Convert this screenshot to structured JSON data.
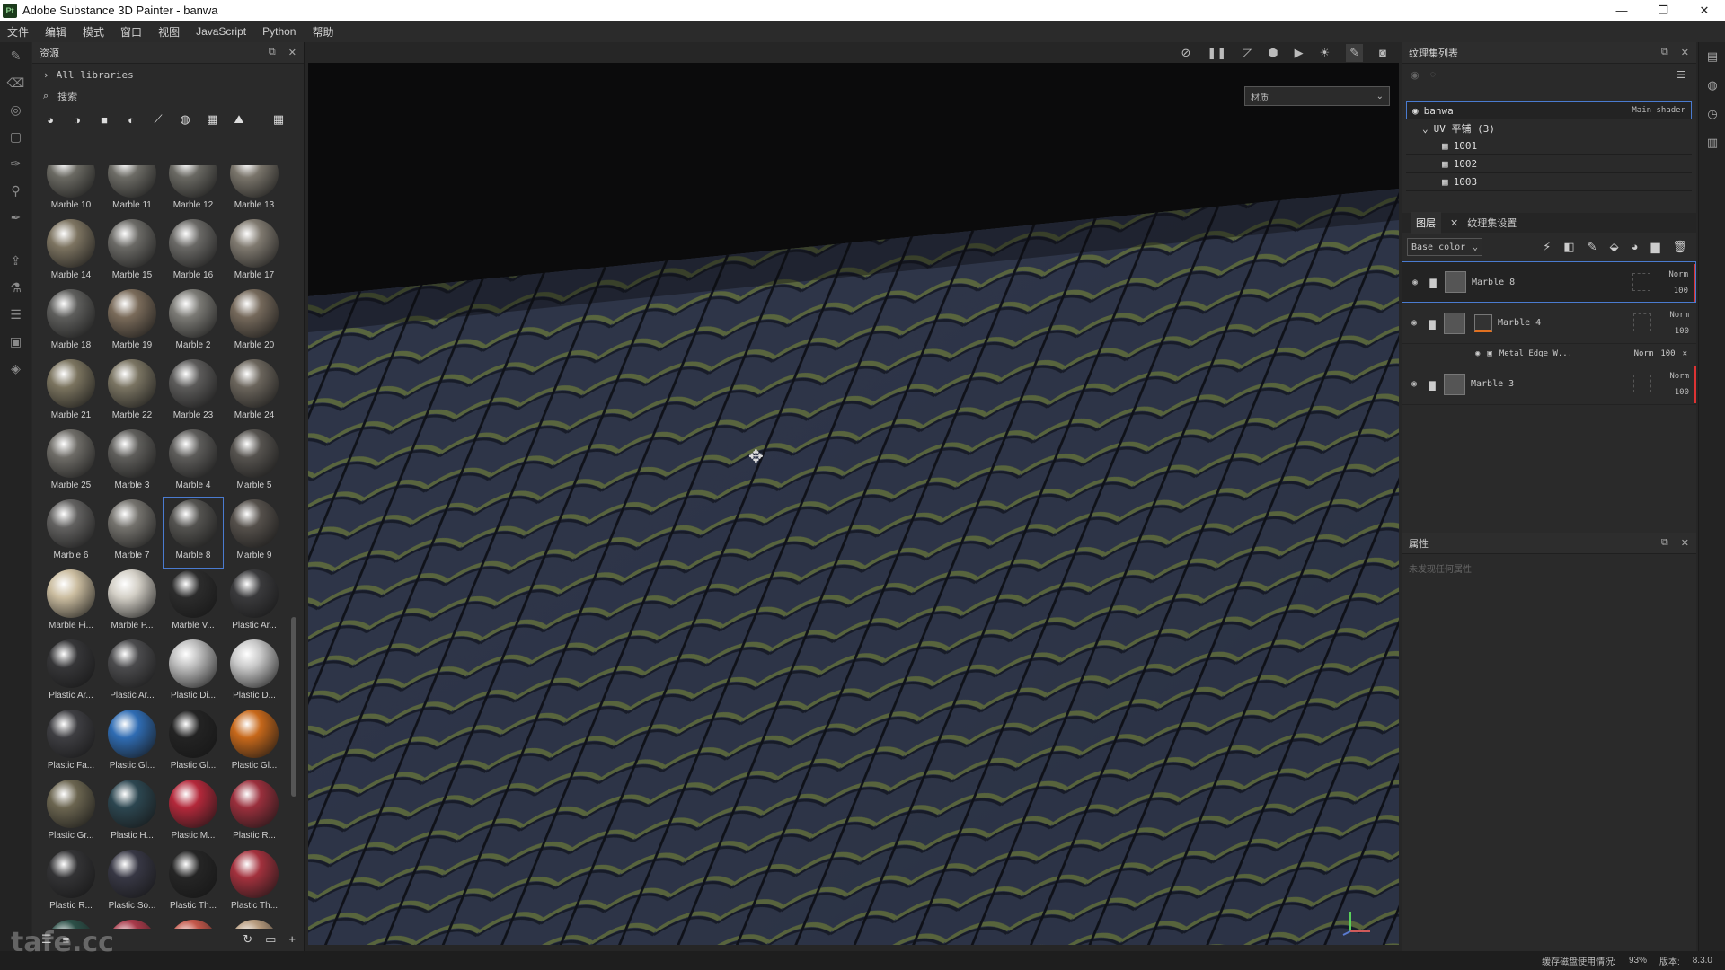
{
  "app": {
    "title": "Adobe Substance 3D Painter - banwa",
    "logo": "Pt"
  },
  "window_controls": {
    "minimize": "—",
    "maximize": "❐",
    "close": "✕"
  },
  "menu": [
    "文件",
    "编辑",
    "模式",
    "窗口",
    "视图",
    "JavaScript",
    "Python",
    "帮助"
  ],
  "assets": {
    "title": "资源",
    "breadcrumb": "All libraries",
    "search_placeholder": "搜索",
    "items": [
      {
        "name": "Marble 10",
        "color": "#6b6a63"
      },
      {
        "name": "Marble 11",
        "color": "#6d6c66"
      },
      {
        "name": "Marble 12",
        "color": "#6a6963"
      },
      {
        "name": "Marble 13",
        "color": "#7a756b"
      },
      {
        "name": "Marble 14",
        "color": "#7d7461"
      },
      {
        "name": "Marble 15",
        "color": "#6b6a66"
      },
      {
        "name": "Marble 16",
        "color": "#6a6966"
      },
      {
        "name": "Marble 17",
        "color": "#807a70"
      },
      {
        "name": "Marble 18",
        "color": "#5e5e5c"
      },
      {
        "name": "Marble 19",
        "color": "#7a6b5a"
      },
      {
        "name": "Marble 2",
        "color": "#7b7a75"
      },
      {
        "name": "Marble 20",
        "color": "#75695b"
      },
      {
        "name": "Marble 21",
        "color": "#7b745f"
      },
      {
        "name": "Marble 22",
        "color": "#7a7462"
      },
      {
        "name": "Marble 23",
        "color": "#5c5b5a"
      },
      {
        "name": "Marble 24",
        "color": "#6b655c"
      },
      {
        "name": "Marble 25",
        "color": "#6e6c67"
      },
      {
        "name": "Marble 3",
        "color": "#5f5e5b"
      },
      {
        "name": "Marble 4",
        "color": "#5d5c5a"
      },
      {
        "name": "Marble 5",
        "color": "#56534f"
      },
      {
        "name": "Marble 6",
        "color": "#626160"
      },
      {
        "name": "Marble 7",
        "color": "#74726d"
      },
      {
        "name": "Marble 8",
        "color": "#545350"
      },
      {
        "name": "Marble 9",
        "color": "#55504b"
      },
      {
        "name": "Marble Fi...",
        "color": "#cbbda0"
      },
      {
        "name": "Marble P...",
        "color": "#d3cfc6"
      },
      {
        "name": "Marble V...",
        "color": "#2c2c2c"
      },
      {
        "name": "Plastic Ar...",
        "color": "#3a3a3c"
      },
      {
        "name": "Plastic Ar...",
        "color": "#363638"
      },
      {
        "name": "Plastic Ar...",
        "color": "#4b4b4d"
      },
      {
        "name": "Plastic Di...",
        "color": "#bdbdbd"
      },
      {
        "name": "Plastic D...",
        "color": "#c8c8c8"
      },
      {
        "name": "Plastic Fa...",
        "color": "#3e3e42"
      },
      {
        "name": "Plastic Gl...",
        "color": "#2f6cb3"
      },
      {
        "name": "Plastic Gl...",
        "color": "#232323"
      },
      {
        "name": "Plastic Gl...",
        "color": "#c7681a"
      },
      {
        "name": "Plastic Gr...",
        "color": "#6b6550"
      },
      {
        "name": "Plastic H...",
        "color": "#2c4650"
      },
      {
        "name": "Plastic M...",
        "color": "#b3283a"
      },
      {
        "name": "Plastic R...",
        "color": "#9a2f3c"
      },
      {
        "name": "Plastic R...",
        "color": "#333335"
      },
      {
        "name": "Plastic So...",
        "color": "#373744"
      },
      {
        "name": "Plastic Th...",
        "color": "#252525"
      },
      {
        "name": "Plastic Th...",
        "color": "#a3313d"
      },
      {
        "name": "",
        "color": "#2c5048"
      },
      {
        "name": "",
        "color": "#a83a4a"
      },
      {
        "name": "",
        "color": "#c4584b"
      },
      {
        "name": "",
        "color": "#b89c7f"
      }
    ],
    "selected": "Marble 8"
  },
  "viewport": {
    "material_dropdown": "材质"
  },
  "texture_sets": {
    "title": "纹理集列表",
    "root": {
      "name": "banwa",
      "shader": "Main shader"
    },
    "uv_group": "UV 平铺 (3)",
    "tiles": [
      "1001",
      "1002",
      "1003"
    ]
  },
  "layers": {
    "tab_layers": "图层",
    "tab_settings": "纹理集设置",
    "channel": "Base color",
    "items": [
      {
        "name": "Marble 8",
        "blend": "Norm",
        "opacity": "100",
        "selected": true
      },
      {
        "name": "Marble 4",
        "blend": "Norm",
        "opacity": "100",
        "selected": false,
        "effect": {
          "name": "Metal Edge W...",
          "blend": "Norm",
          "opacity": "100"
        }
      },
      {
        "name": "Marble 3",
        "blend": "Norm",
        "opacity": "100",
        "selected": false
      }
    ]
  },
  "properties": {
    "title": "属性",
    "empty": "未发现任何属性"
  },
  "status": {
    "disk": "缓存磁盘使用情况:",
    "disk_pct": "93%",
    "version_label": "版本:",
    "version": "8.3.0"
  },
  "watermark": "tafe.cc",
  "colors": {
    "accent": "#4a7bd0",
    "layer_marker": "#dd3333"
  }
}
